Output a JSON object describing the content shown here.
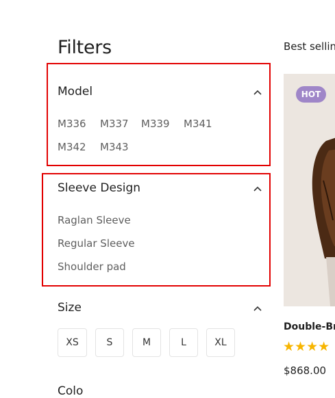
{
  "filters": {
    "title": "Filters",
    "model": {
      "title": "Model",
      "options": [
        "M336",
        "M337",
        "M339",
        "M341",
        "M342",
        "M343"
      ]
    },
    "sleeve": {
      "title": "Sleeve Design",
      "options": [
        "Raglan Sleeve",
        "Regular Sleeve",
        "Shoulder pad"
      ]
    },
    "size": {
      "title": "Size",
      "options": [
        "XS",
        "S",
        "M",
        "L",
        "XL"
      ]
    },
    "next_section_partial": "Colo"
  },
  "product_listing": {
    "sort_label": "Best selling",
    "product": {
      "badge": "HOT",
      "name": "Double-Bre",
      "rating_stars": "★★★★",
      "price": "$868.00"
    }
  },
  "colors": {
    "highlight": "#e20000",
    "badge": "#9f86c8",
    "star": "#f7b500"
  }
}
